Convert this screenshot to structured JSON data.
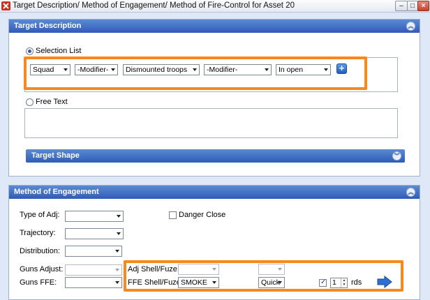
{
  "window": {
    "title": "Target Description/ Method of Engagement/ Method of Fire-Control for Asset 20",
    "controls": {
      "minimize": "–",
      "maximize": "□",
      "close": "×"
    },
    "icon": "app-icon"
  },
  "target_description": {
    "header": "Target Description",
    "selection_list_label": "Selection List",
    "selection_list_selected": true,
    "combos": [
      "Squad",
      "-Modifier-",
      "Dismounted troops",
      "-Modifier-",
      "In open"
    ],
    "add_icon": "plus-icon",
    "free_text_label": "Free Text",
    "free_text_value": "",
    "target_shape_header": "Target Shape"
  },
  "method_of_engagement": {
    "header": "Method of Engagement",
    "type_of_adj_label": "Type of Adj:",
    "trajectory_label": "Trajectory:",
    "distribution_label": "Distribution:",
    "guns_adjust_label": "Guns Adjust:",
    "guns_ffe_label": "Guns FFE:",
    "danger_close_label": "Danger Close",
    "adj_shell_fuze_label": "Adj Shell/Fuze:",
    "ffe_shell_fuze_label": "FFE Shell/Fuze:",
    "ffe_shell_value": "SMOKE",
    "ffe_fuze_value": "Quick",
    "rounds_checked": true,
    "rounds_value": "1",
    "rounds_unit": "rds",
    "go_icon": "arrow-right-icon"
  },
  "colors": {
    "highlight": "#f68a1e",
    "header": "#2e5cb7"
  }
}
